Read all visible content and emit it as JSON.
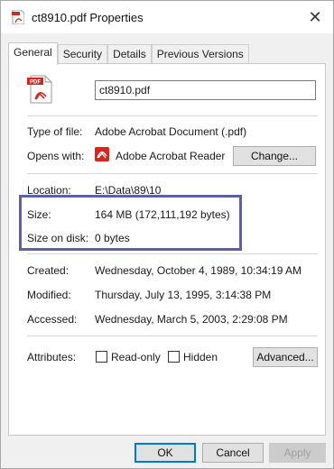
{
  "window": {
    "title": "ct8910.pdf Properties",
    "close_glyph": "✕"
  },
  "tabs": [
    {
      "label": "General",
      "active": true
    },
    {
      "label": "Security",
      "active": false
    },
    {
      "label": "Details",
      "active": false
    },
    {
      "label": "Previous Versions",
      "active": false
    }
  ],
  "general": {
    "file_icon_text": "PDF",
    "filename": "ct8910.pdf",
    "type_label": "Type of file:",
    "type_value": "Adobe Acrobat Document (.pdf)",
    "opens_label": "Opens with:",
    "opens_value": "Adobe Acrobat Reader",
    "change_button": "Change...",
    "location_label": "Location:",
    "location_value": "E:\\Data\\89\\10",
    "size_label": "Size:",
    "size_value": "164 MB (172,111,192 bytes)",
    "size_on_disk_label": "Size on disk:",
    "size_on_disk_value": "0 bytes",
    "created_label": "Created:",
    "created_value": "Wednesday, October 4, 1989, 10:34:19 AM",
    "modified_label": "Modified:",
    "modified_value": "Thursday, July 13, 1995, 3:14:38 PM",
    "accessed_label": "Accessed:",
    "accessed_value": "Wednesday, March 5, 2003, 2:29:08 PM",
    "attributes_label": "Attributes:",
    "readonly_label": "Read-only",
    "hidden_label": "Hidden",
    "advanced_button": "Advanced..."
  },
  "footer": {
    "ok_button": "OK",
    "cancel_button": "Cancel",
    "apply_button": "Apply"
  },
  "colors": {
    "pdf_red": "#d9251d",
    "highlight_border": "#5a5fa6",
    "default_button_border": "#0078d7"
  }
}
